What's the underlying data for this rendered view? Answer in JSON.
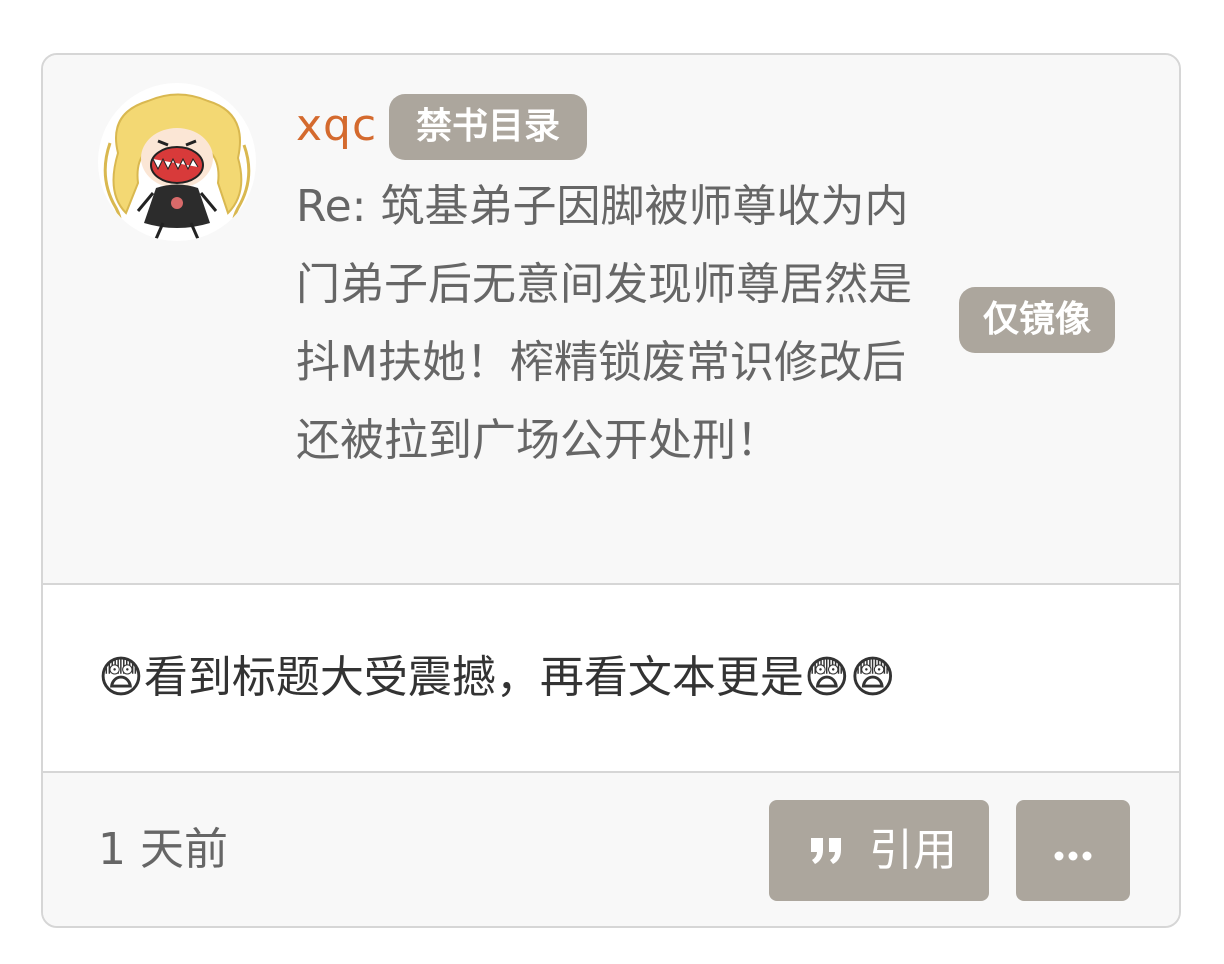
{
  "post": {
    "username": "xqc",
    "tag": "禁书目录",
    "title": "Re: 筑基弟子因脚被师尊收为内门弟子后无意间发现师尊居然是抖M扶她！榨精锁废常识修改后还被拉到广场公开处刑！",
    "mirror_badge": "仅镜像",
    "comment": "😨看到标题大受震撼，再看文本更是😨😨",
    "time": "1 天前",
    "quote_label": "引用"
  },
  "icons": {
    "quote": "quote-icon",
    "more": "more-dots-icon",
    "avatar": "avatar-anime-girl"
  },
  "colors": {
    "username": "#d46a2e",
    "badge_bg": "#aca69d",
    "header_bg": "#f8f8f8",
    "border": "#d6d6d6"
  }
}
